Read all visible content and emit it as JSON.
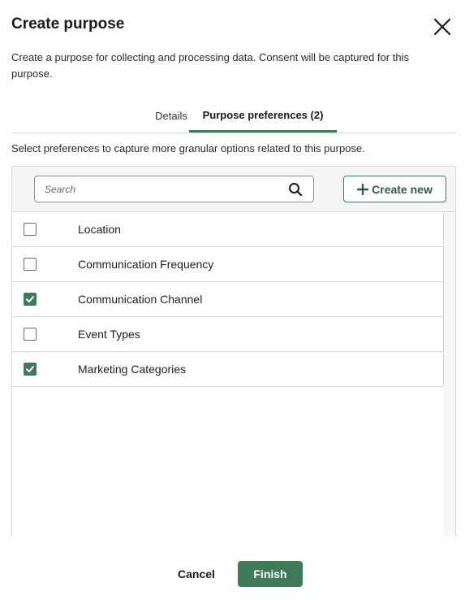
{
  "dialog": {
    "title": "Create purpose",
    "description": "Create a purpose for collecting and processing data. Consent will be captured for this purpose.",
    "close_icon": "close-icon"
  },
  "tabs": [
    {
      "label": "Details",
      "active": false
    },
    {
      "label": "Purpose preferences (2)",
      "active": true
    }
  ],
  "helper_text": "Select preferences to capture more granular options related to this purpose.",
  "toolbar": {
    "search_placeholder": "Search",
    "search_icon": "magnifier-icon",
    "create_label": "Create new",
    "create_icon": "plus-icon"
  },
  "preferences": [
    {
      "label": "Location",
      "checked": false
    },
    {
      "label": "Communication Frequency",
      "checked": false
    },
    {
      "label": "Communication Channel",
      "checked": true
    },
    {
      "label": "Event Types",
      "checked": false
    },
    {
      "label": "Marketing Categories",
      "checked": true
    }
  ],
  "footer": {
    "cancel_label": "Cancel",
    "finish_label": "Finish"
  },
  "colors": {
    "accent": "#3e7a57",
    "accent_dark": "#2d5c41",
    "border": "#d8d8d8",
    "toolbar_bg": "#f5f5f5"
  }
}
